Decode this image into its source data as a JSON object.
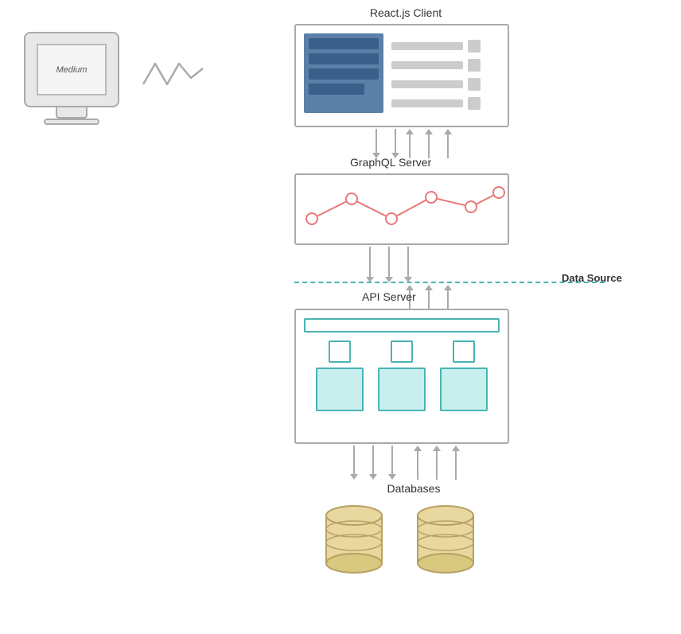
{
  "labels": {
    "reactjs": "React.js Client",
    "graphql": "GraphQL Server",
    "api": "API Server",
    "databases": "Databases",
    "datasource": "Data Source",
    "medium": "Medium"
  },
  "colors": {
    "border": "#aaa",
    "teal": "#4ab3b3",
    "blue": "#5b7fa6",
    "darkblue": "#3a5f8a",
    "pink": "#e87878",
    "cylinder_top": "#e8d8a0",
    "cylinder_border": "#b8a060"
  }
}
